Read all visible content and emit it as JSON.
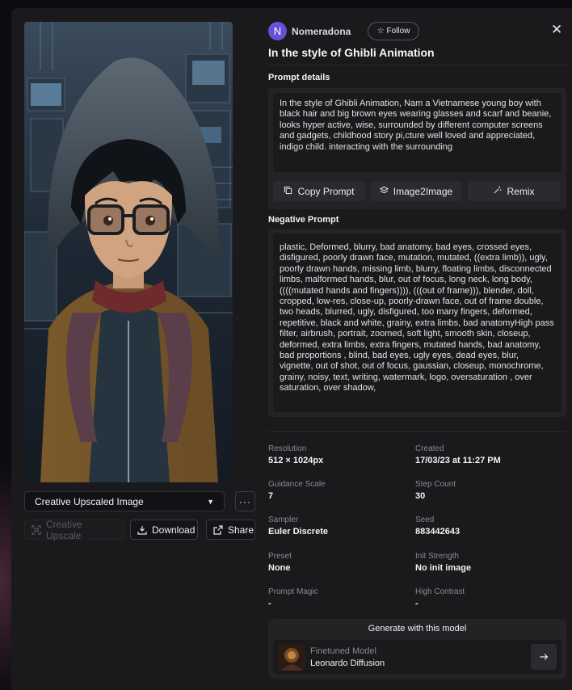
{
  "user": {
    "avatar_initial": "N",
    "name": "Nomeradona",
    "follow_label": "Follow"
  },
  "title": "In the style of Ghibli Animation",
  "prompt": {
    "label": "Prompt details",
    "text": "In the style of Ghibli Animation, Nam a Vietnamese young boy with black hair and big brown eyes wearing glasses and scarf and beanie, looks hyper active, wise, surrounded by different computer screens and gadgets, childhood story pi,cture well loved and appreciated, indigo child. interacting with the surrounding",
    "copy_label": "Copy Prompt",
    "img2img_label": "Image2Image",
    "remix_label": "Remix"
  },
  "negative": {
    "label": "Negative Prompt",
    "text": "plastic, Deformed, blurry, bad anatomy, bad eyes, crossed eyes, disfigured, poorly drawn face, mutation, mutated, ((extra limb)), ugly, poorly drawn hands, missing limb, blurry, floating limbs, disconnected limbs, malformed hands, blur, out of focus, long neck, long body, ((((mutated hands and fingers)))), (((out of frame))), blender, doll, cropped, low-res, close-up, poorly-drawn face, out of frame double, two heads, blurred, ugly, disfigured, too many fingers, deformed, repetitive, black and white, grainy, extra limbs, bad anatomyHigh pass filter, airbrush, portrait, zoomed, soft light, smooth skin, closeup, deformed, extra limbs, extra fingers, mutated hands, bad anatomy, bad proportions , blind, bad eyes, ugly eyes, dead eyes, blur, vignette, out of shot, out of focus, gaussian, closeup, monochrome, grainy, noisy, text, writing, watermark, logo, oversaturation , over saturation, over shadow,"
  },
  "meta": {
    "resolution": {
      "label": "Resolution",
      "value": "512 × 1024px"
    },
    "created": {
      "label": "Created",
      "value": "17/03/23 at 11:27 PM"
    },
    "guidance": {
      "label": "Guidance Scale",
      "value": "7"
    },
    "steps": {
      "label": "Step Count",
      "value": "30"
    },
    "sampler": {
      "label": "Sampler",
      "value": "Euler Discrete"
    },
    "seed": {
      "label": "Seed",
      "value": "883442643"
    },
    "preset": {
      "label": "Preset",
      "value": "None"
    },
    "init_strength": {
      "label": "Init Strength",
      "value": "No init image"
    },
    "prompt_magic": {
      "label": "Prompt Magic",
      "value": "-"
    },
    "high_contrast": {
      "label": "High Contrast",
      "value": "-"
    }
  },
  "generate": {
    "title": "Generate with this model",
    "model_kind": "Finetuned Model",
    "model_name": "Leonardo Diffusion"
  },
  "image_controls": {
    "variant_selected": "Creative Upscaled Image",
    "more_label": "···",
    "upscale_label": "Creative Upscale",
    "download_label": "Download",
    "share_label": "Share"
  },
  "colors": {
    "avatar": "#6a4fd8",
    "panel": "#1a1a1c",
    "box": "#232326"
  }
}
